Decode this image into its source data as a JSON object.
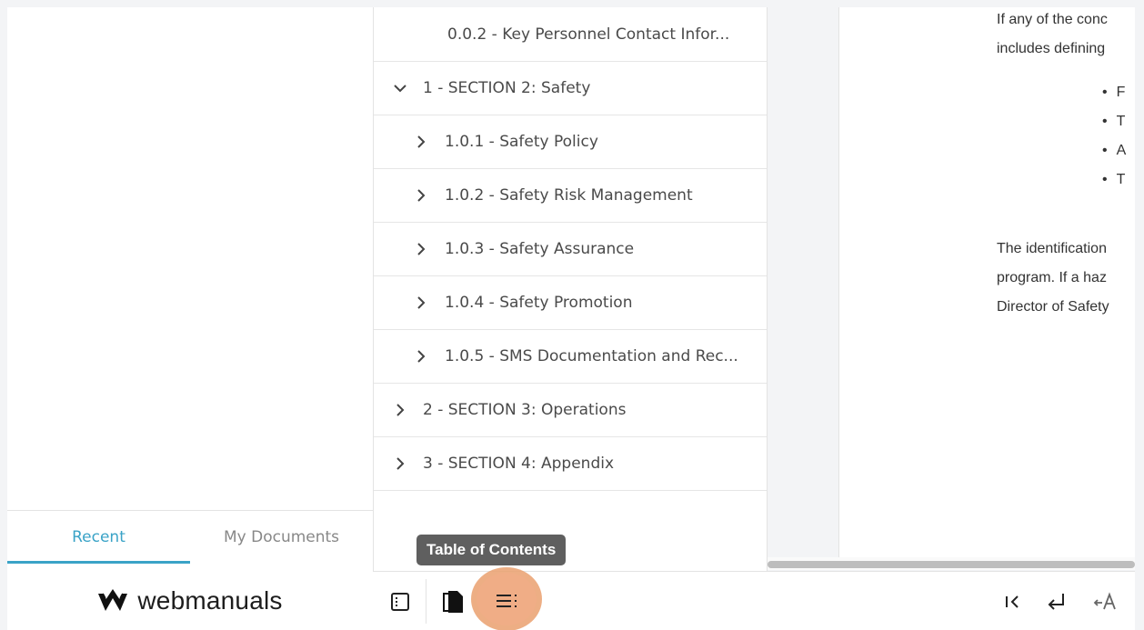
{
  "left_panel": {
    "tabs": [
      {
        "label": "Recent",
        "active": true
      },
      {
        "label": "My Documents",
        "active": false
      }
    ],
    "logo_text": "webmanuals"
  },
  "toc": {
    "items": [
      {
        "label": "0.0.2 - Key Personnel Contact Infor...",
        "level": 2,
        "expandable": false
      },
      {
        "label": "1 - SECTION 2: Safety",
        "level": 0,
        "expanded": true
      },
      {
        "label": "1.0.1 - Safety Policy",
        "level": 1,
        "expanded": false
      },
      {
        "label": "1.0.2 - Safety Risk Management",
        "level": 1,
        "expanded": false
      },
      {
        "label": "1.0.3 - Safety Assurance",
        "level": 1,
        "expanded": false
      },
      {
        "label": "1.0.4 - Safety Promotion",
        "level": 1,
        "expanded": false
      },
      {
        "label": "1.0.5 - SMS Documentation and Rec...",
        "level": 1,
        "expanded": false
      },
      {
        "label": "2 - SECTION 3: Operations",
        "level": 0,
        "expanded": false
      },
      {
        "label": "3 - SECTION 4: Appendix",
        "level": 0,
        "expanded": false
      }
    ]
  },
  "document": {
    "para1_lines": [
      "If any of the conc",
      "includes defining"
    ],
    "bullets": [
      "F",
      "T",
      "A",
      "T"
    ],
    "para2_lines": [
      "The identification",
      "program. If a haz",
      "Director of Safety"
    ]
  },
  "tooltip": {
    "text": "Table of Contents"
  },
  "colors": {
    "accent": "#3aa3c7",
    "highlight": "#f0ad86",
    "tooltip_bg": "#5f5f5f"
  },
  "icons": {
    "sidebar_toggle": "sidebar-toggle-icon",
    "documents": "documents-icon",
    "toc": "table-of-contents-icon",
    "first_page": "first-page-icon",
    "return": "return-icon",
    "text_format": "text-format-icon"
  }
}
